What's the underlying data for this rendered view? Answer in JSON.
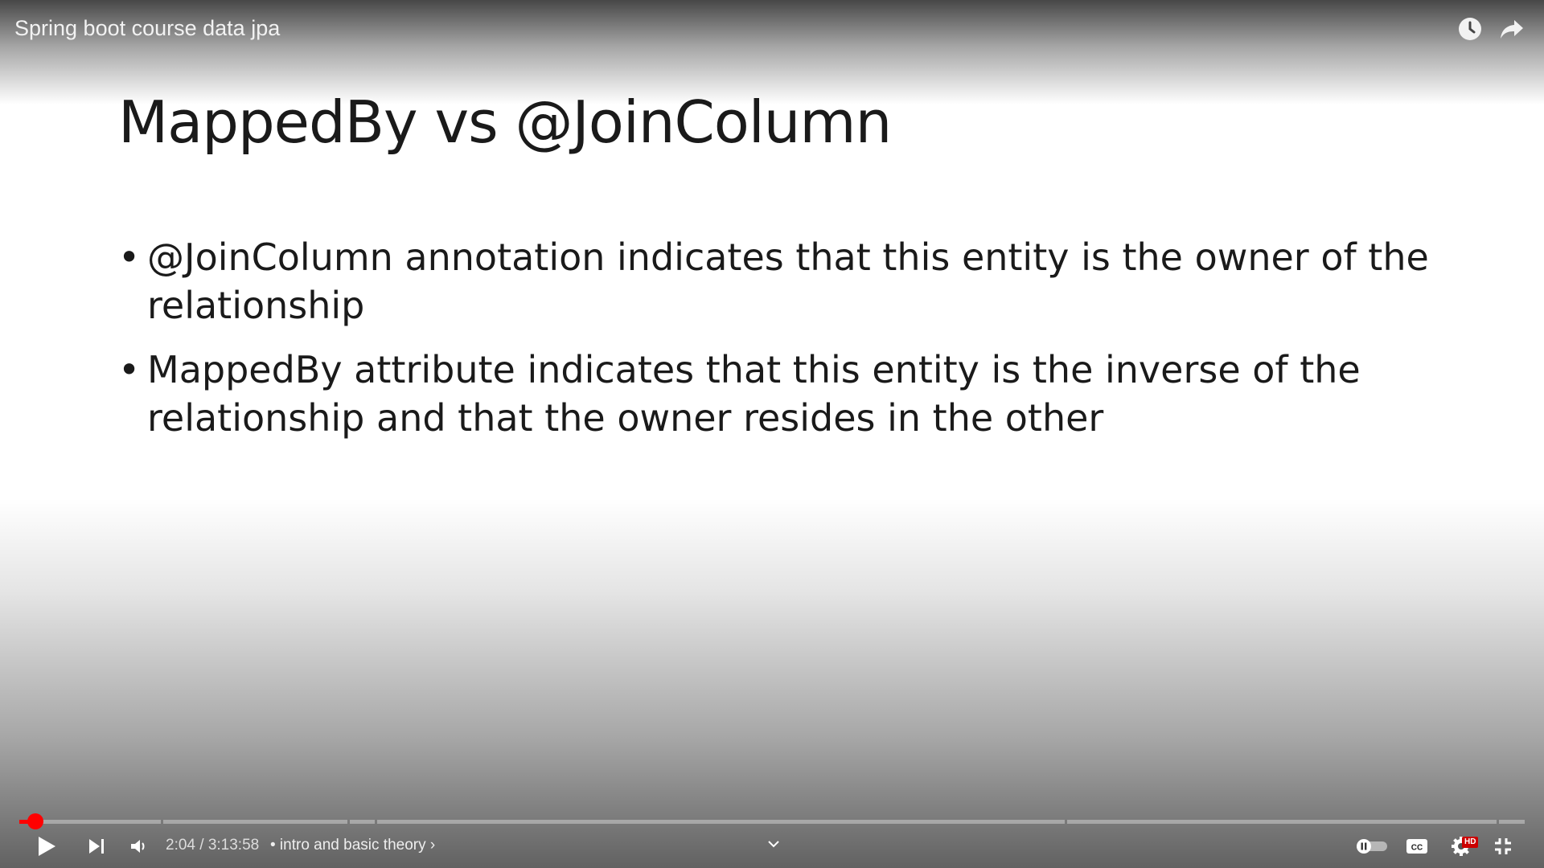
{
  "player": {
    "video_title": "Spring boot course data jpa",
    "time_current": "2:04",
    "time_separator": "/",
    "time_total": "3:13:58",
    "chapter_label": "• intro and basic theory",
    "chapter_chevron": "›",
    "progress_fraction": 0.0107,
    "hd_badge": "HD",
    "accent_color": "#ff0000",
    "icons": {
      "watch_later": "clock-icon",
      "share": "share-arrow-icon",
      "play": "play-icon",
      "next": "next-icon",
      "volume": "volume-icon",
      "expand": "chevron-down-icon",
      "autoplay": "autoplay-toggle-icon",
      "captions": "cc-icon",
      "settings": "gear-icon",
      "exit_fullscreen": "exit-fullscreen-icon"
    }
  },
  "slide": {
    "title": "MappedBy vs @JoinColumn",
    "bullets": [
      "@JoinColumn annotation indicates that this entity is the owner of the relationship",
      "MappedBy attribute indicates that this entity is the inverse of the relationship and that the owner resides in the other"
    ]
  }
}
